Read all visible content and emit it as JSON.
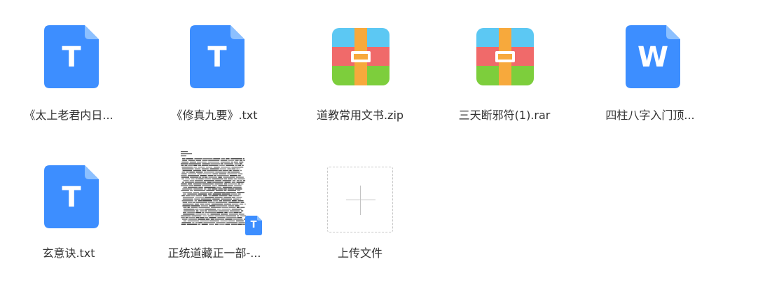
{
  "colors": {
    "doc_blue": "#3d8eff",
    "doc_fold": "#8cc0ff",
    "word_blue": "#3d8eff",
    "zip_sky": "#5cc8f3",
    "zip_red": "#f06a6a",
    "zip_green": "#7dce3c",
    "zip_orange": "#f7a93c",
    "label_text": "#333333",
    "upload_border": "#c8c8c8"
  },
  "files": [
    {
      "name": "《太上老君内日...",
      "icon": "txt-file-icon",
      "letter": "T"
    },
    {
      "name": "《修真九要》.txt",
      "icon": "txt-file-icon",
      "letter": "T"
    },
    {
      "name": "道教常用文书.zip",
      "icon": "archive-icon"
    },
    {
      "name": "三天断邪符(1).rar",
      "icon": "archive-icon"
    },
    {
      "name": "四柱八字入门顶...",
      "icon": "word-file-icon",
      "letter": "W"
    },
    {
      "name": "玄意诀.txt",
      "icon": "txt-file-icon",
      "letter": "T"
    },
    {
      "name": "正统道藏正一部-...",
      "icon": "document-thumbnail-icon",
      "badge_letter": "T"
    }
  ],
  "upload": {
    "label": "上传文件",
    "icon": "plus-icon"
  }
}
